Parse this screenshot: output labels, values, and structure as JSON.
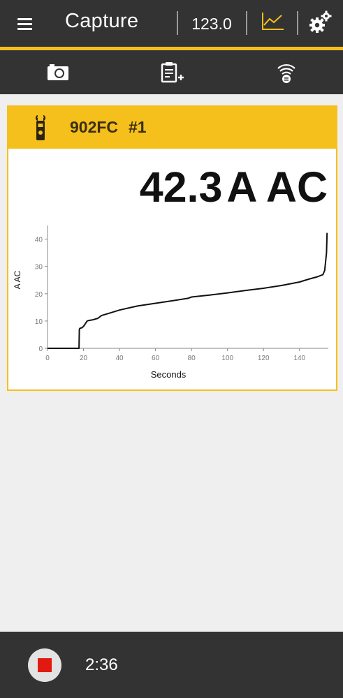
{
  "appbar": {
    "title": "Capture",
    "reading": "123.0",
    "menu_icon": "hamburger-menu-icon",
    "graph_icon": "line-graph-icon",
    "settings_icon": "gears-icon",
    "accent_color": "#f6c01c",
    "bar_color": "#333333"
  },
  "toolbar": {
    "items": [
      {
        "icon": "camera-icon"
      },
      {
        "icon": "clipboard-add-icon"
      },
      {
        "icon": "wireless-device-icon"
      }
    ]
  },
  "device_card": {
    "model": "902FC",
    "number": "#1",
    "icon": "clamp-meter-icon",
    "reading_value": "42.3",
    "reading_unit": "A AC"
  },
  "chart_data": {
    "type": "line",
    "xlabel": "Seconds",
    "ylabel": "A AC",
    "xlim": [
      0,
      156
    ],
    "ylim": [
      0,
      45
    ],
    "xticks": [
      0,
      20,
      40,
      60,
      80,
      100,
      120,
      140
    ],
    "yticks": [
      0,
      10,
      20,
      30,
      40
    ],
    "x": [
      0,
      17.5,
      17.7,
      18,
      19,
      20,
      21,
      22,
      23,
      25,
      28,
      30,
      35,
      40,
      50,
      60,
      70,
      78,
      80,
      90,
      100,
      110,
      120,
      130,
      140,
      145,
      150,
      153,
      154,
      155,
      155.3
    ],
    "y": [
      0,
      0,
      7,
      7.3,
      7.5,
      8,
      9,
      10,
      10.2,
      10.4,
      11,
      12,
      13,
      14,
      15.5,
      16.5,
      17.5,
      18.3,
      18.8,
      19.5,
      20.3,
      21.2,
      22,
      23,
      24.3,
      25.3,
      26.2,
      27,
      28.5,
      35,
      42.3
    ],
    "grid": false
  },
  "bottombar": {
    "stop_icon": "stop-record-icon",
    "elapsed": "2:36"
  }
}
